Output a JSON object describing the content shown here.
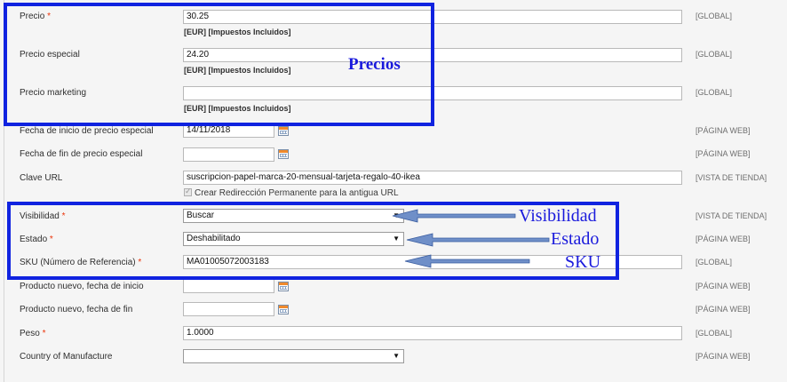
{
  "rows": {
    "precio": {
      "label": "Precio",
      "required": true,
      "value": "30.25",
      "note": "[EUR] [Impuestos Incluidos]",
      "scope": "[GLOBAL]"
    },
    "precio_especial": {
      "label": "Precio especial",
      "value": "24.20",
      "note": "[EUR] [Impuestos Incluidos]",
      "scope": "[GLOBAL]"
    },
    "precio_marketing": {
      "label": "Precio marketing",
      "value": "",
      "note": "[EUR] [Impuestos Incluidos]",
      "scope": "[GLOBAL]"
    },
    "fecha_inicio": {
      "label": "Fecha de inicio de precio especial",
      "value": "14/11/2018",
      "scope": "[PÁGINA WEB]"
    },
    "fecha_fin": {
      "label": "Fecha de fin de precio especial",
      "value": "",
      "scope": "[PÁGINA WEB]"
    },
    "clave_url": {
      "label": "Clave URL",
      "value": "suscripcion-papel-marca-20-mensual-tarjeta-regalo-40-ikea",
      "checkbox_label": "Crear Redirección Permanente para la antigua URL",
      "checked": true,
      "scope": "[VISTA DE TIENDA]"
    },
    "visibilidad": {
      "label": "Visibilidad",
      "required": true,
      "value": "Buscar",
      "scope": "[VISTA DE TIENDA]"
    },
    "estado": {
      "label": "Estado",
      "required": true,
      "value": "Deshabilitado",
      "scope": "[PÁGINA WEB]"
    },
    "sku": {
      "label": "SKU (Número de Referencia)",
      "required": true,
      "value": "MA01005072003183",
      "scope": "[GLOBAL]"
    },
    "nuevo_inicio": {
      "label": "Producto nuevo, fecha de inicio",
      "value": "",
      "scope": "[PÁGINA WEB]"
    },
    "nuevo_fin": {
      "label": "Producto nuevo, fecha de fin",
      "value": "",
      "scope": "[PÁGINA WEB]"
    },
    "peso": {
      "label": "Peso",
      "required": true,
      "value": "1.0000",
      "scope": "[GLOBAL]"
    },
    "country": {
      "label": "Country of Manufacture",
      "value": "",
      "scope": "[PÁGINA WEB]"
    }
  },
  "required_marker": "*",
  "annotations": {
    "precios": "Precios",
    "visibilidad": "Visibilidad",
    "estado": "Estado",
    "sku": "SKU"
  },
  "icons": {
    "calendar": "calendar-icon",
    "select_arrow": "▼"
  },
  "colors": {
    "annotation_blue": "#1023e0",
    "required_red": "#eb340a",
    "arrow_fill": "#6f8fc8"
  }
}
